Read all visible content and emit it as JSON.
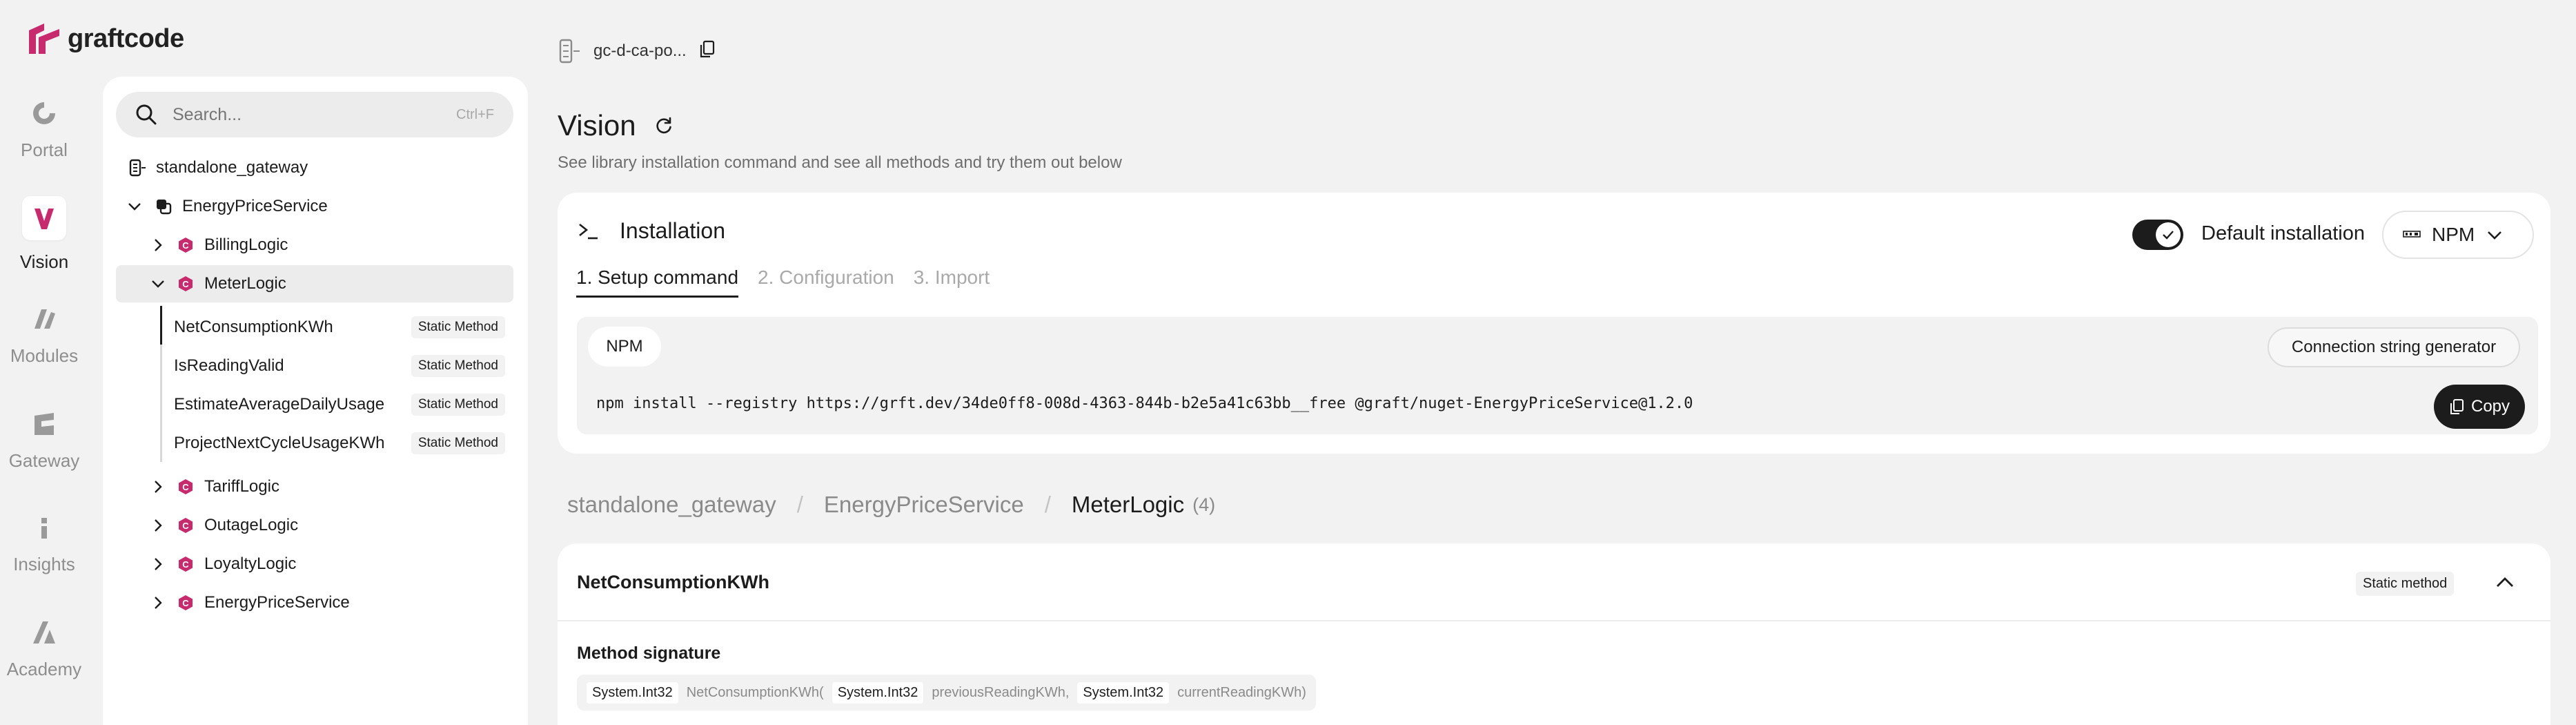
{
  "brand": {
    "name": "graftcode",
    "color": "#c72a6d"
  },
  "rail": [
    {
      "label": "Portal",
      "icon": "portal-icon"
    },
    {
      "label": "Vision",
      "icon": "vision-icon",
      "active": true
    },
    {
      "label": "Modules",
      "icon": "modules-icon"
    },
    {
      "label": "Gateway",
      "icon": "gateway-icon"
    },
    {
      "label": "Insights",
      "icon": "insights-icon"
    },
    {
      "label": "Academy",
      "icon": "academy-icon"
    }
  ],
  "search": {
    "placeholder": "Search...",
    "shortcut": "Ctrl+F"
  },
  "tree": {
    "gateway": "standalone_gateway",
    "service": "EnergyPriceService",
    "classes": [
      "BillingLogic",
      "MeterLogic",
      "TariffLogic",
      "OutageLogic",
      "LoyaltyLogic",
      "EnergyPriceService"
    ],
    "methods": [
      {
        "name": "NetConsumptionKWh",
        "tag": "Static Method"
      },
      {
        "name": "IsReadingValid",
        "tag": "Static Method"
      },
      {
        "name": "EstimateAverageDailyUsage",
        "tag": "Static Method"
      },
      {
        "name": "ProjectNextCycleUsageKWh",
        "tag": "Static Method"
      }
    ]
  },
  "topbar": {
    "gateway_short": "gc-d-ca-po..."
  },
  "page": {
    "title": "Vision",
    "subtitle": "See library installation command and see all methods and try them out below"
  },
  "install": {
    "title": "Installation",
    "default_label": "Default installation",
    "default_on": true,
    "package_manager": "NPM",
    "tabs": [
      "1. Setup command",
      "2. Configuration",
      "3. Import"
    ],
    "active_tab": 0,
    "pill": "NPM",
    "conn_button": "Connection string generator",
    "command": "npm install --registry https://grft.dev/34de0ff8-008d-4363-844b-b2e5a41c63bb__free @graft/nuget-EnergyPriceService@1.2.0",
    "copy_label": "Copy"
  },
  "breadcrumb": {
    "items": [
      "standalone_gateway",
      "EnergyPriceService",
      "MeterLogic"
    ],
    "separator": "/",
    "count": "(4)"
  },
  "method": {
    "name": "NetConsumptionKWh",
    "tag": "Static method",
    "signature_label": "Method signature",
    "signature": {
      "return_type": "System.Int32",
      "name": "NetConsumptionKWh(",
      "p1_type": "System.Int32",
      "p1_name": "previousReadingKWh,",
      "p2_type": "System.Int32",
      "p2_name": "currentReadingKWh)"
    }
  }
}
